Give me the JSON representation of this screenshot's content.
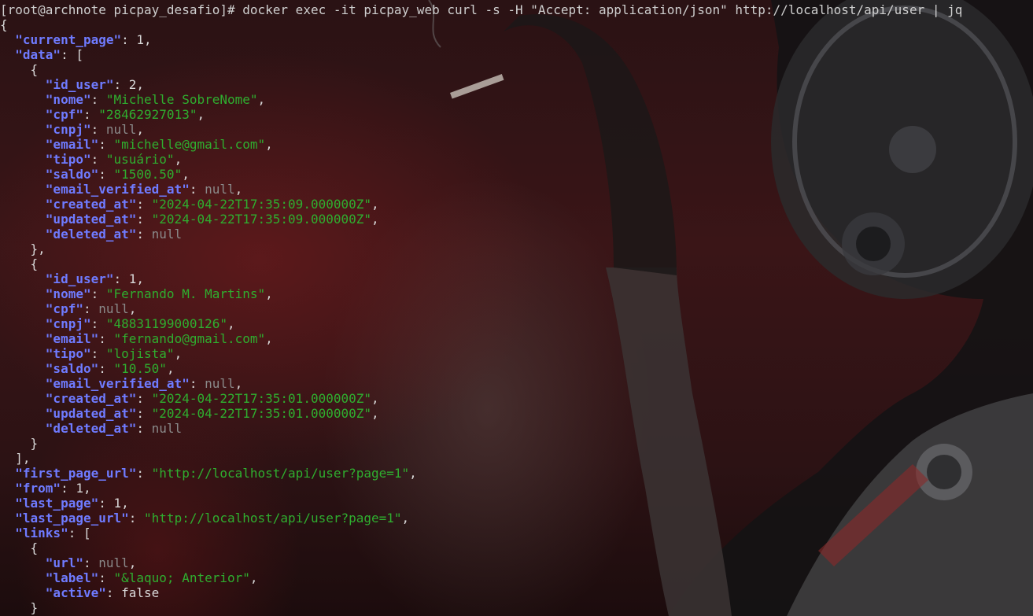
{
  "terminal": {
    "prompt": "[root@archnote picpay_desafio]# ",
    "command": "docker exec -it picpay_web curl -s -H \"Accept: application/json\" http://localhost/api/user | jq"
  },
  "colors": {
    "key": "#6f7bff",
    "string": "#2fae2f",
    "null": "#8a8a8a",
    "punctuation": "#d8d8d8"
  },
  "json_output": {
    "current_page": 1,
    "data": [
      {
        "id_user": 2,
        "nome": "Michelle SobreNome",
        "cpf": "28462927013",
        "cnpj": null,
        "email": "michelle@gmail.com",
        "tipo": "usuário",
        "saldo": "1500.50",
        "email_verified_at": null,
        "created_at": "2024-04-22T17:35:09.000000Z",
        "updated_at": "2024-04-22T17:35:09.000000Z",
        "deleted_at": null
      },
      {
        "id_user": 1,
        "nome": "Fernando M. Martins",
        "cpf": null,
        "cnpj": "48831199000126",
        "email": "fernando@gmail.com",
        "tipo": "lojista",
        "saldo": "10.50",
        "email_verified_at": null,
        "created_at": "2024-04-22T17:35:01.000000Z",
        "updated_at": "2024-04-22T17:35:01.000000Z",
        "deleted_at": null
      }
    ],
    "first_page_url": "http://localhost/api/user?page=1",
    "from": 1,
    "last_page": 1,
    "last_page_url": "http://localhost/api/user?page=1",
    "links": [
      {
        "url": null,
        "label": "&laquo; Anterior",
        "active": false
      }
    ]
  }
}
